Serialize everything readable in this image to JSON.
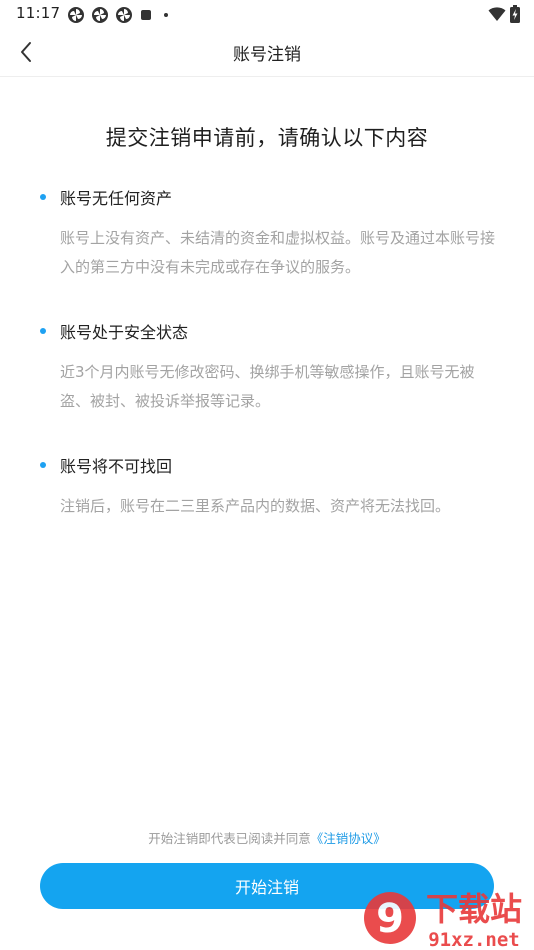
{
  "status_bar": {
    "time": "11:17"
  },
  "nav": {
    "title": "账号注销"
  },
  "heading": "提交注销申请前，请确认以下内容",
  "items": [
    {
      "title": "账号无任何资产",
      "desc": "账号上没有资产、未结清的资金和虚拟权益。账号及通过本账号接入的第三方中没有未完成或存在争议的服务。"
    },
    {
      "title": "账号处于安全状态",
      "desc": "近3个月内账号无修改密码、换绑手机等敏感操作，且账号无被盗、被封、被投诉举报等记录。"
    },
    {
      "title": "账号将不可找回",
      "desc": "注销后，账号在二三里系产品内的数据、资产将无法找回。"
    }
  ],
  "agreement": {
    "prefix": "开始注销即代表已阅读并同意",
    "link": "《注销协议》"
  },
  "start_button": "开始注销",
  "watermark": {
    "big": "下载站",
    "logo_number": "9",
    "site": "91xz.net"
  },
  "colors": {
    "accent": "#14a4f0",
    "bullet": "#1ea1f2",
    "desc_text": "#a3a3a3",
    "watermark_red": "#e8393a"
  }
}
